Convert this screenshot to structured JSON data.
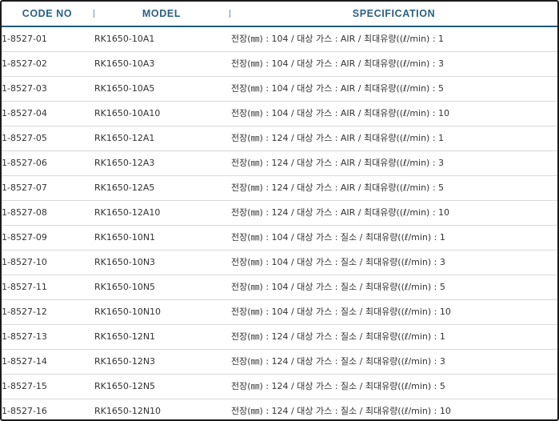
{
  "table": {
    "headers": {
      "code": "CODE NO",
      "model": "MODEL",
      "spec": "SPECIFICATION"
    },
    "rows": [
      {
        "code": "1-8527-01",
        "model": "RK1650-10A1",
        "spec": "전장(㎜) : 104 / 대상 가스 : AIR / 최대유량((ℓ/min) : 1"
      },
      {
        "code": "1-8527-02",
        "model": "RK1650-10A3",
        "spec": "전장(㎜) : 104 / 대상 가스 : AIR / 최대유량((ℓ/min) : 3"
      },
      {
        "code": "1-8527-03",
        "model": "RK1650-10A5",
        "spec": "전장(㎜) : 104 / 대상 가스 : AIR / 최대유량((ℓ/min) : 5"
      },
      {
        "code": "1-8527-04",
        "model": "RK1650-10A10",
        "spec": "전장(㎜) : 104 / 대상 가스 : AIR / 최대유량((ℓ/min) : 10"
      },
      {
        "code": "1-8527-05",
        "model": "RK1650-12A1",
        "spec": "전장(㎜) : 124 / 대상 가스 : AIR / 최대유량((ℓ/min) : 1"
      },
      {
        "code": "1-8527-06",
        "model": "RK1650-12A3",
        "spec": "전장(㎜) : 124 / 대상 가스 : AIR / 최대유량((ℓ/min) : 3"
      },
      {
        "code": "1-8527-07",
        "model": "RK1650-12A5",
        "spec": "전장(㎜) : 124 / 대상 가스 : AIR / 최대유량((ℓ/min) : 5"
      },
      {
        "code": "1-8527-08",
        "model": "RK1650-12A10",
        "spec": "전장(㎜) : 124 / 대상 가스 : AIR / 최대유량((ℓ/min) : 10"
      },
      {
        "code": "1-8527-09",
        "model": "RK1650-10N1",
        "spec": "전장(㎜) : 104 / 대상 가스 : 질소 / 최대유량((ℓ/min) : 1"
      },
      {
        "code": "1-8527-10",
        "model": "RK1650-10N3",
        "spec": "전장(㎜) : 104 / 대상 가스 : 질소 / 최대유량((ℓ/min) : 3"
      },
      {
        "code": "1-8527-11",
        "model": "RK1650-10N5",
        "spec": "전장(㎜) : 104 / 대상 가스 : 질소 / 최대유량((ℓ/min) : 5"
      },
      {
        "code": "1-8527-12",
        "model": "RK1650-10N10",
        "spec": "전장(㎜) : 104 / 대상 가스 : 질소 / 최대유량((ℓ/min) : 10"
      },
      {
        "code": "1-8527-13",
        "model": "RK1650-12N1",
        "spec": "전장(㎜) : 124 / 대상 가스 : 질소 / 최대유량((ℓ/min) : 1"
      },
      {
        "code": "1-8527-14",
        "model": "RK1650-12N3",
        "spec": "전장(㎜) : 124 / 대상 가스 : 질소 / 최대유량((ℓ/min) : 3"
      },
      {
        "code": "1-8527-15",
        "model": "RK1650-12N5",
        "spec": "전장(㎜) : 124 / 대상 가스 : 질소 / 최대유량((ℓ/min) : 5"
      },
      {
        "code": "1-8527-16",
        "model": "RK1650-12N10",
        "spec": "전장(㎜) : 124 / 대상 가스 : 질소 / 최대유량((ℓ/min) : 10"
      }
    ]
  },
  "colors": {
    "header_text": "#2b5f82",
    "header_rule": "#1f5a78",
    "body_text": "#333333",
    "row_divider": "#d9d9d9"
  }
}
